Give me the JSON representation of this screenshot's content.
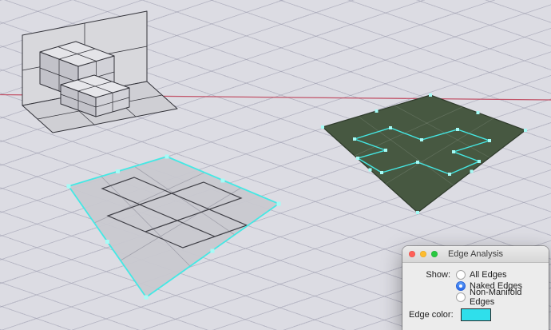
{
  "viewport": {
    "background_color": "#dcdce3",
    "grid_color": "#b9b9c6",
    "axis_color": "#c25469",
    "selection_color": "#45e8e4",
    "point_color": "#a5fbf6",
    "unrolled_surface_fill": "#c9c9cf",
    "analysis_surface_fill": "#475841",
    "model_edge_color": "#33333a"
  },
  "dialog": {
    "title": "Edge Analysis",
    "show_label": "Show:",
    "options": [
      {
        "label": "All Edges",
        "selected": false
      },
      {
        "label": "Naked Edges",
        "selected": true
      },
      {
        "label": "Non-Manifold Edges",
        "selected": false
      }
    ],
    "edge_color_label": "Edge color:",
    "edge_color": "#2fdfeb",
    "traffic_lights": [
      {
        "name": "close",
        "color": "#ff5f57"
      },
      {
        "name": "minimize",
        "color": "#febc2e"
      },
      {
        "name": "zoom",
        "color": "#28c840"
      }
    ]
  }
}
